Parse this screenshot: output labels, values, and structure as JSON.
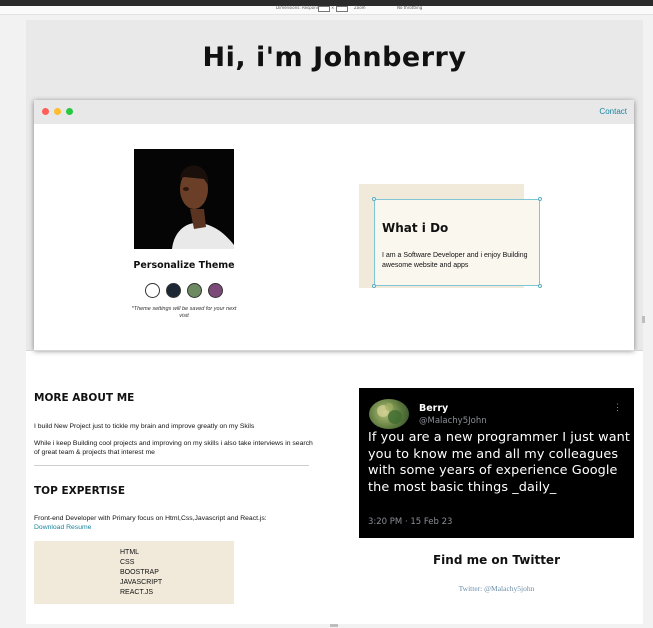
{
  "toolbar": {
    "items": [
      "Dimensions: Responsive",
      "Zoom",
      "No throttling"
    ],
    "width_value": "",
    "height_value": ""
  },
  "hero": {
    "title": "Hi, i'm Johnberry"
  },
  "window": {
    "contact_label": "Contact",
    "dot_colors": [
      "#ff5f57",
      "#febc2e",
      "#28c840"
    ]
  },
  "theme": {
    "title": "Personalize Theme",
    "note": "*Theme settings will be saved for your next visit",
    "swatches": [
      "#ffffff",
      "#1c2833",
      "#6d8a62",
      "#7b4a78"
    ]
  },
  "what_i_do": {
    "title": "What i Do",
    "text": "I am a Software Developer and i enjoy Building awesome website and apps"
  },
  "about": {
    "title": "MORE ABOUT ME",
    "p1": "I build New Project just to tickle my brain and improve greatly on my Skils",
    "p2": "While i keep Building cool projects and improving on my skills i also take interviews in search of great team & projects that interest me"
  },
  "expertise": {
    "title": "TOP EXPERTISE",
    "text": "Front-end Developer with Primary focus on Html,Css,Javascript and React.js:",
    "resume_link": "Download Resume",
    "skills": [
      "HTML",
      "CSS",
      "BOOSTRAP",
      "JAVASCRIPT",
      "REACT.JS"
    ]
  },
  "tweet": {
    "name": "Berry",
    "handle": "@Malachy5John",
    "menu": "⋮",
    "text": "If you are a new programmer I just want you to know me and all my colleagues with some years of experience Google the most basic things _daily_",
    "time": "3:20 PM · 15 Feb 23"
  },
  "twitter": {
    "title": "Find me on Twitter",
    "link": "Twitter: @Malachy5john"
  }
}
